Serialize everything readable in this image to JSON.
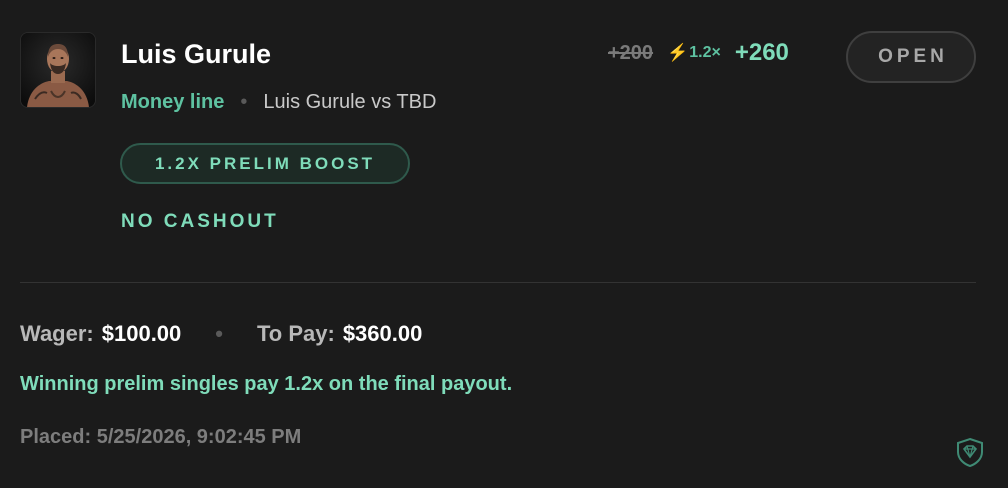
{
  "bet": {
    "fighter_name": "Luis Gurule",
    "market_type": "Money line",
    "separator": "•",
    "matchup": "Luis Gurule vs TBD",
    "status": "OPEN"
  },
  "odds": {
    "original": "+200",
    "boost_multiplier": "1.2×",
    "boosted": "+260"
  },
  "tags": {
    "promo": "1.2X PRELIM BOOST",
    "no_cashout": "NO CASHOUT"
  },
  "summary": {
    "wager_label": "Wager:",
    "wager_value": "$100.00",
    "to_pay_label": "To Pay:",
    "to_pay_value": "$360.00",
    "promo_note": "Winning prelim singles pay 1.2x on the final payout.",
    "placed_label": "Placed:",
    "placed_value": "5/25/2026, 9:02:45 PM"
  },
  "icons": {
    "avatar": "fighter-headshot",
    "boost": "lightning-bolt-icon",
    "brand": "shield-diamond-icon"
  },
  "colors": {
    "accent": "#7fdcba",
    "accent_dim": "#5ec2a1",
    "background": "#1b1b1b",
    "bolt": "#f2c230"
  }
}
